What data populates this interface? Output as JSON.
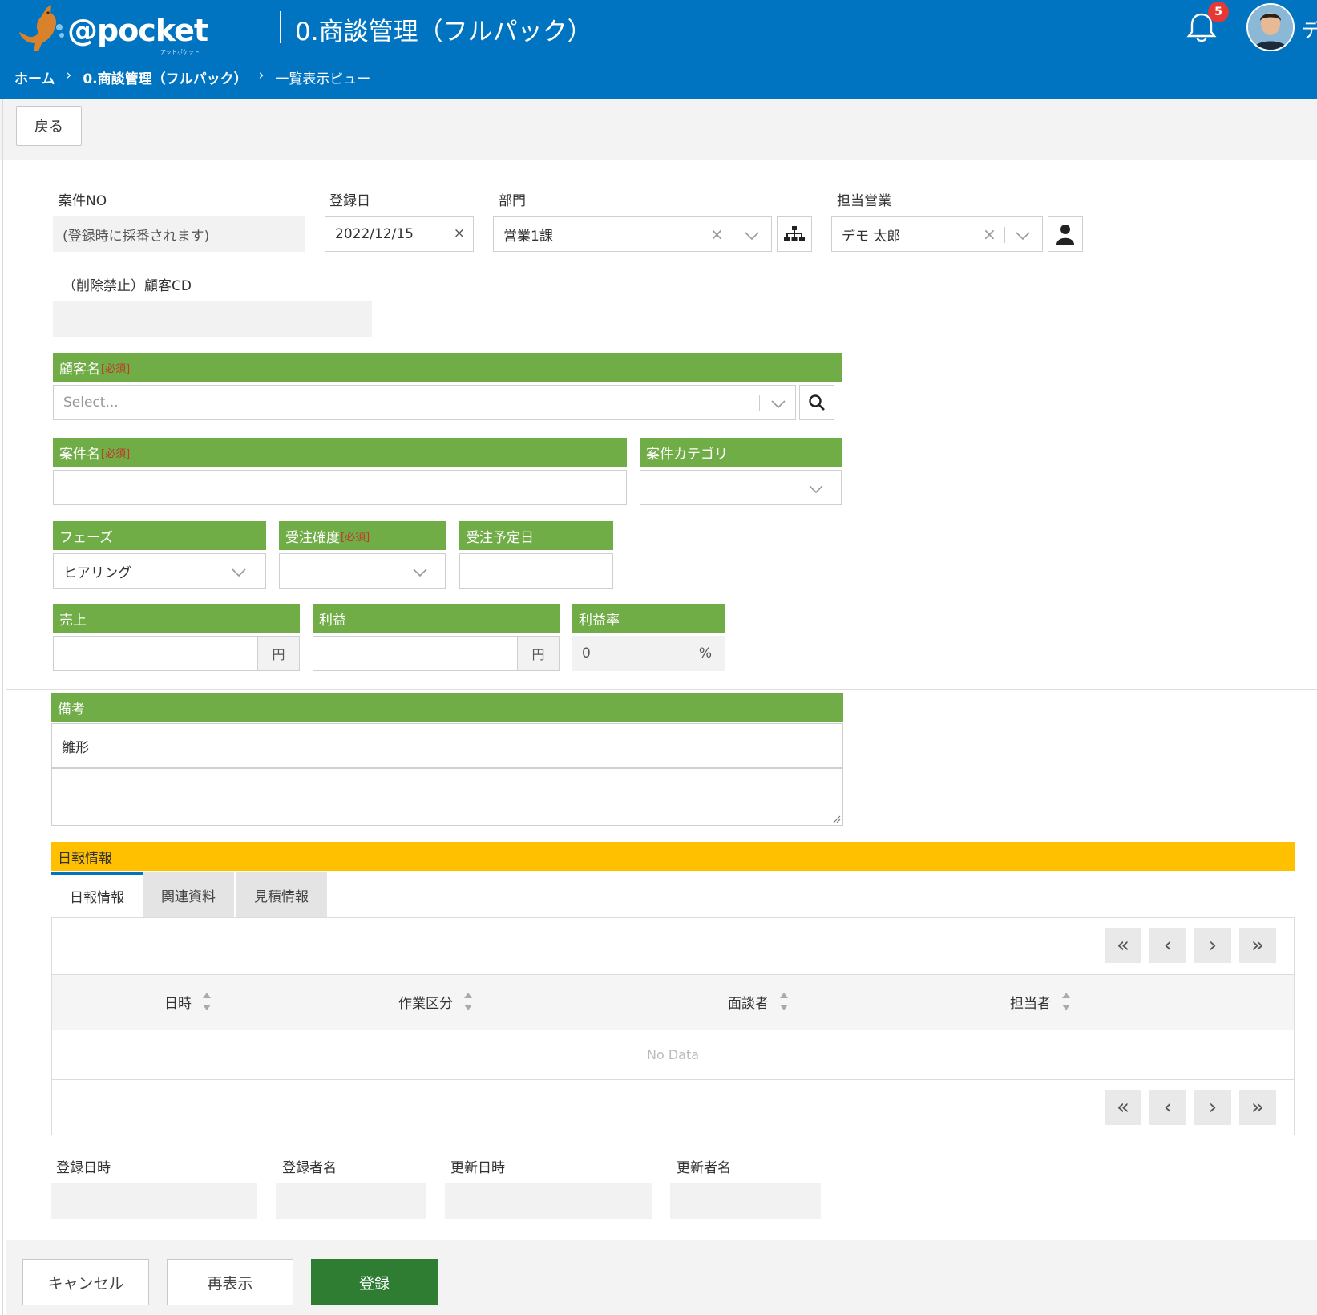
{
  "header": {
    "logo_text": "@pocket",
    "logo_sub": "アットポケット",
    "app_title": "0.商談管理（フルパック）",
    "notification_count": "5",
    "user_initial": "デ"
  },
  "breadcrumb": {
    "home": "ホーム",
    "module": "0.商談管理（フルパック）",
    "current": "一覧表示ビュー",
    "separator": "›"
  },
  "toolbar": {
    "back_label": "戻る"
  },
  "form": {
    "case_no": {
      "label": "案件NO",
      "value": "(登録時に採番されます)"
    },
    "reg_date": {
      "label": "登録日",
      "value": "2022/12/15",
      "clear": "×"
    },
    "department": {
      "label": "部門",
      "value": "営業1課",
      "clear": "×"
    },
    "sales_rep": {
      "label": "担当営業",
      "value": "デモ 太郎",
      "clear": "×"
    },
    "customer_cd": {
      "label": "（削除禁止）顧客CD",
      "value": ""
    },
    "customer_name": {
      "label": "顧客名",
      "required": "[必須]",
      "placeholder": "Select..."
    },
    "case_name": {
      "label": "案件名",
      "required": "[必須]",
      "value": ""
    },
    "case_category": {
      "label": "案件カテゴリ",
      "value": ""
    },
    "phase": {
      "label": "フェーズ",
      "value": "ヒアリング"
    },
    "order_prob": {
      "label": "受注確度",
      "required": "[必須]",
      "value": ""
    },
    "order_date": {
      "label": "受注予定日",
      "value": ""
    },
    "sales": {
      "label": "売上",
      "unit": "円",
      "value": ""
    },
    "profit": {
      "label": "利益",
      "unit": "円",
      "value": ""
    },
    "profit_rate": {
      "label": "利益率",
      "value": "0",
      "unit": "%"
    },
    "notes": {
      "label": "備考",
      "value": "雛形"
    }
  },
  "daily_report": {
    "section_title": "日報情報",
    "tabs": [
      {
        "label": "日報情報",
        "active": true
      },
      {
        "label": "関連資料",
        "active": false
      },
      {
        "label": "見積情報",
        "active": false
      }
    ],
    "columns": [
      "日時",
      "作業区分",
      "面談者",
      "担当者"
    ],
    "empty_text": "No Data",
    "pager": {
      "first": "«",
      "prev": "‹",
      "next": "›",
      "last": "»"
    }
  },
  "meta": {
    "created_at": {
      "label": "登録日時",
      "value": ""
    },
    "created_by": {
      "label": "登録者名",
      "value": ""
    },
    "updated_at": {
      "label": "更新日時",
      "value": ""
    },
    "updated_by": {
      "label": "更新者名",
      "value": ""
    }
  },
  "footer": {
    "cancel_label": "キャンセル",
    "refresh_label": "再表示",
    "submit_label": "登録"
  },
  "colors": {
    "header_blue": "#0074c1",
    "field_green": "#70ad47",
    "section_yellow": "#ffc000",
    "submit_green": "#2e7d32",
    "badge_red": "#e53935"
  }
}
